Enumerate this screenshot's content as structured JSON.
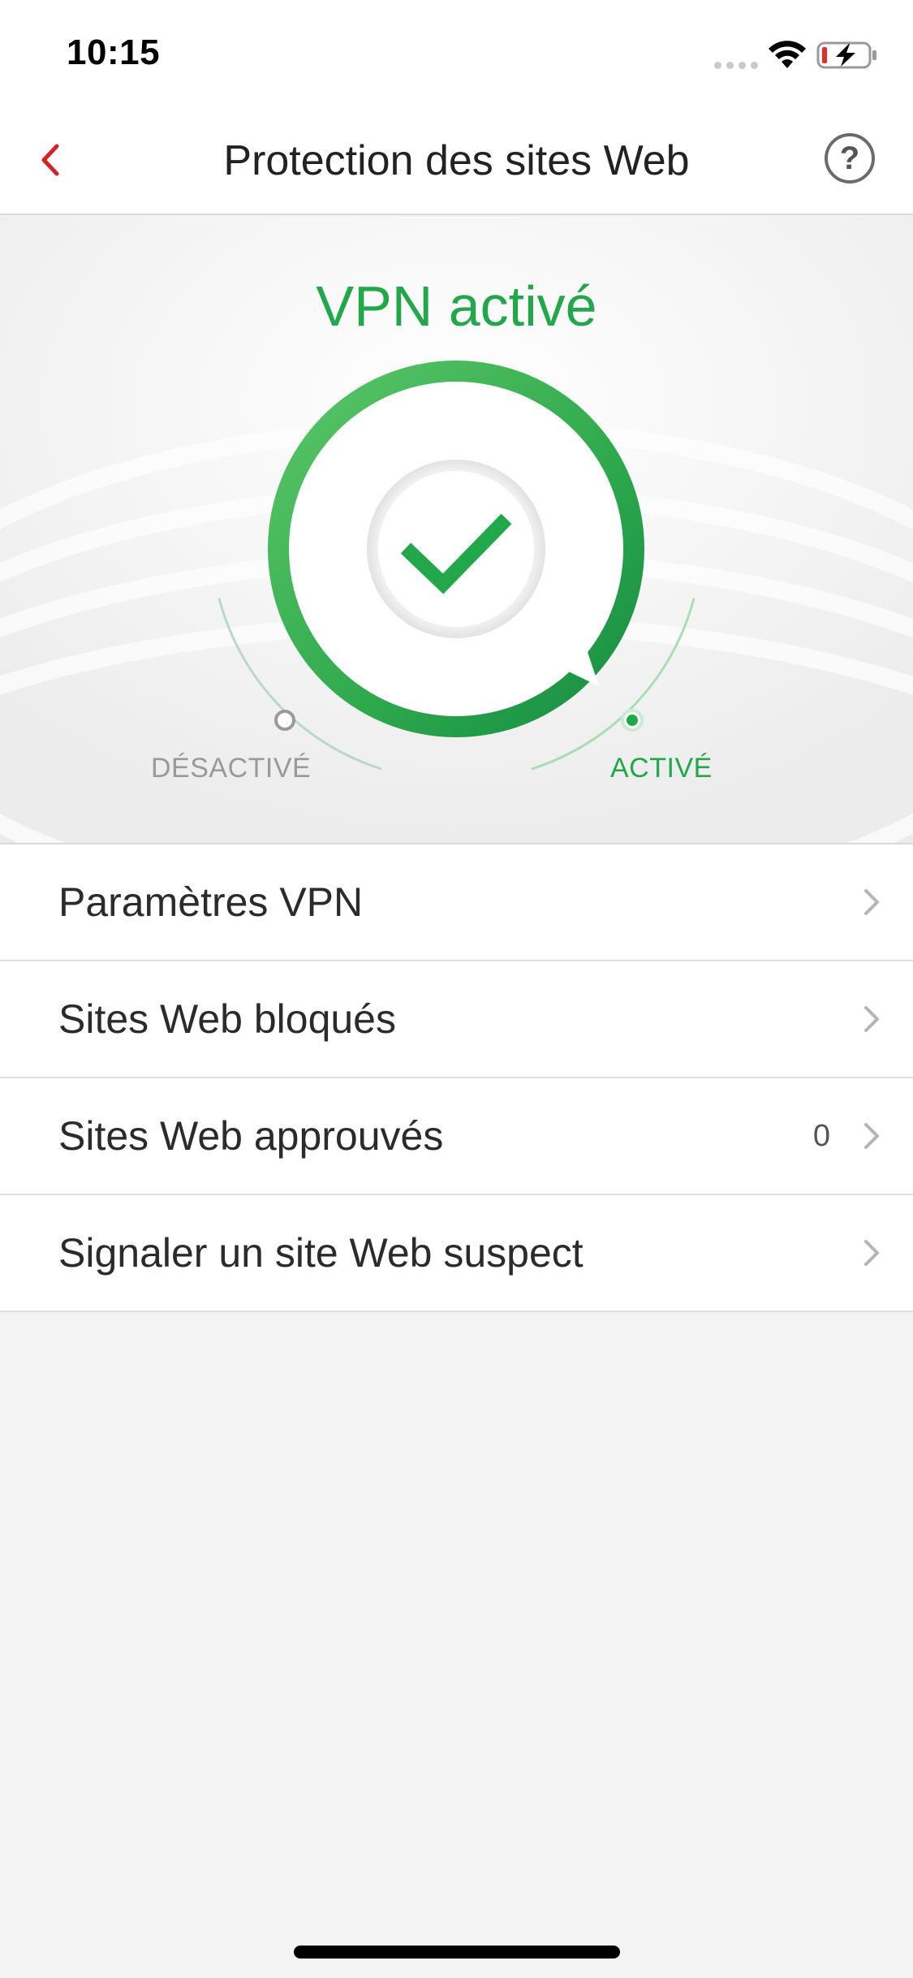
{
  "status_bar": {
    "time": "10:15",
    "icons": [
      "signal-dots-icon",
      "wifi-icon",
      "battery-charging-icon"
    ]
  },
  "nav": {
    "title": "Protection des sites Web",
    "back_icon": "chevron-left-icon",
    "help_label": "?"
  },
  "hero": {
    "title": "VPN activé",
    "label_off": "DÉSACTIVÉ",
    "label_on": "ACTIVÉ",
    "state": "on",
    "center_icon": "checkmark-icon"
  },
  "menu": {
    "items": [
      {
        "label": "Paramètres VPN",
        "count": ""
      },
      {
        "label": "Sites Web bloqués",
        "count": ""
      },
      {
        "label": "Sites Web approuvés",
        "count": "0"
      },
      {
        "label": "Signaler un site Web suspect",
        "count": ""
      }
    ]
  },
  "colors": {
    "accent_green": "#22a74a",
    "back_red": "#d2232a",
    "background": "#f3f3f3"
  }
}
